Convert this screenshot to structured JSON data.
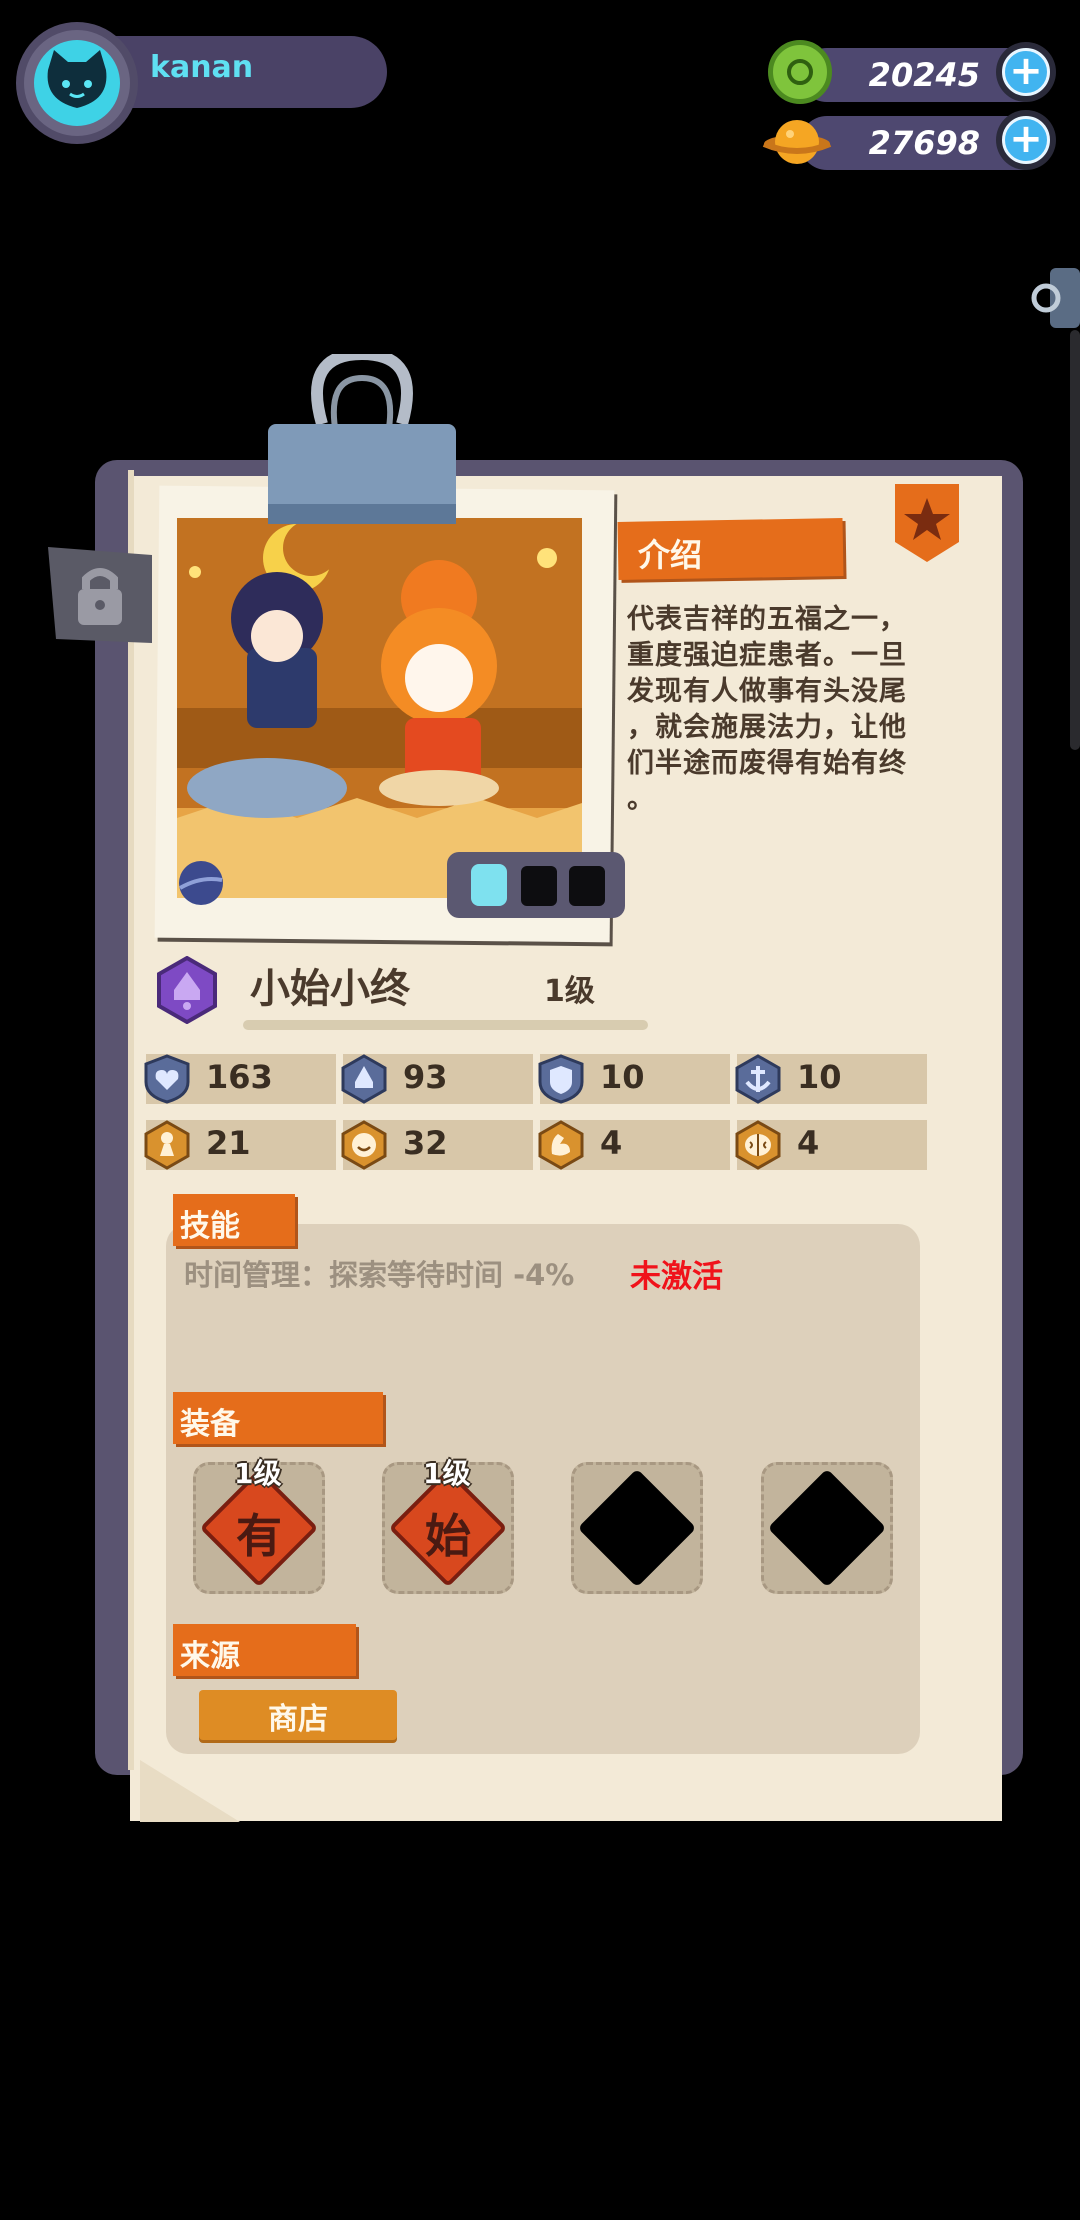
{
  "profile": {
    "username": "kanan",
    "avatar": "cat-avatar-icon"
  },
  "currency": {
    "gem": {
      "icon": "green-donut-coin-icon",
      "amount": "20245"
    },
    "planet": {
      "icon": "orange-planet-coin-icon",
      "amount": "27698"
    },
    "add_symbol": "+"
  },
  "character": {
    "name": "小始小终",
    "level": "1级",
    "class_icon": "purple-bell-class-icon",
    "favorite_icon": "star-badge-icon",
    "intro_title": "介绍",
    "intro_lines": [
      "代表吉祥的五福之一，",
      "重度强迫症患者。一旦",
      "发现有人做事有头没尾",
      "，就会施展法力，让他",
      "们半途而废得有始有终",
      "。"
    ]
  },
  "stats": [
    {
      "icon": "heart-shield-icon",
      "value": "163"
    },
    {
      "icon": "bell-shield-icon",
      "value": "93"
    },
    {
      "icon": "shield-icon",
      "value": "10"
    },
    {
      "icon": "anchor-shield-icon",
      "value": "10"
    },
    {
      "icon": "pawn-icon",
      "value": "21"
    },
    {
      "icon": "smile-icon",
      "value": "32"
    },
    {
      "icon": "strength-arm-icon",
      "value": "4"
    },
    {
      "icon": "brain-icon",
      "value": "4"
    }
  ],
  "skill": {
    "title": "技能",
    "text": "时间管理：探索等待时间 -4%",
    "status": "未激活",
    "status_color": "#f0121a"
  },
  "equipment": {
    "title": "装备",
    "slots": [
      {
        "level": "1级",
        "glyph": "有"
      },
      {
        "level": "1级",
        "glyph": "始"
      },
      {
        "level": "",
        "glyph": ""
      },
      {
        "level": "",
        "glyph": ""
      }
    ]
  },
  "source": {
    "title": "来源",
    "button_label": "商店"
  },
  "colors": {
    "accent": "#e56d1b",
    "paper": "#f3ead7",
    "card_back": "#5a5470"
  }
}
